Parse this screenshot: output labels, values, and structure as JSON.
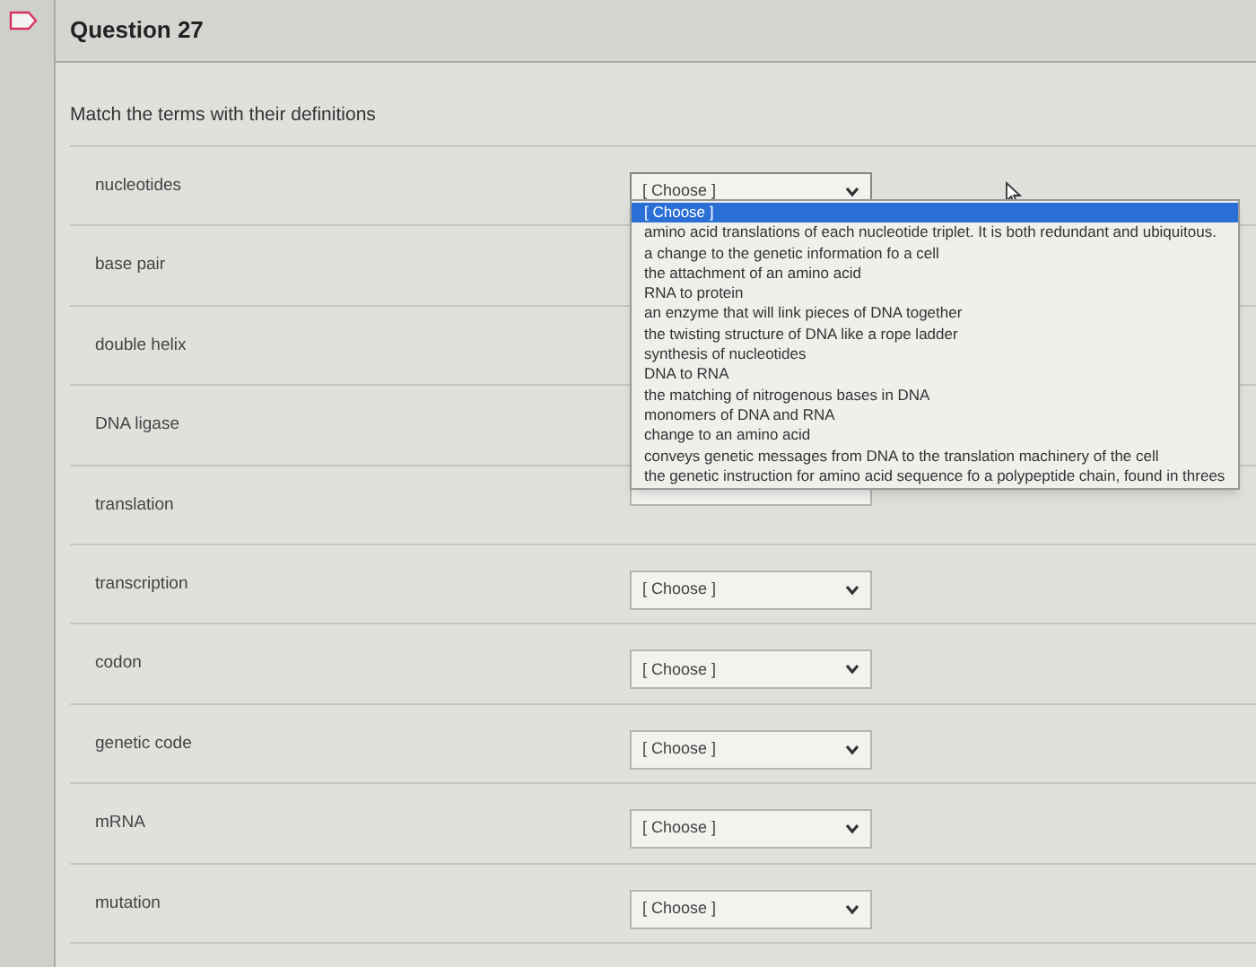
{
  "question": {
    "title": "Question 27",
    "prompt": "Match the terms with their definitions"
  },
  "rows": [
    {
      "term": "nucleotides",
      "choice": "[ Choose ]",
      "open": true
    },
    {
      "term": "base pair"
    },
    {
      "term": "double helix"
    },
    {
      "term": "DNA ligase"
    },
    {
      "term": "translation",
      "covered": true
    },
    {
      "term": "transcription",
      "choice": "[ Choose ]",
      "open": false
    },
    {
      "term": "codon",
      "choice": "[ Choose ]",
      "open": false
    },
    {
      "term": "genetic code",
      "choice": "[ Choose ]",
      "open": false
    },
    {
      "term": "mRNA",
      "choice": "[ Choose ]",
      "open": false
    },
    {
      "term": "mutation",
      "choice": "[ Choose ]",
      "open": false
    }
  ],
  "dropdown": {
    "options": [
      {
        "label": "[ Choose ]",
        "selected": true
      },
      {
        "label": "amino acid translations of each nucleotide triplet. It is both redundant and ubiquitous.",
        "selected": false
      },
      {
        "label": "a change to the genetic information fo a cell",
        "selected": false
      },
      {
        "label": "the attachment of an amino acid",
        "selected": false
      },
      {
        "label": "RNA to protein",
        "selected": false
      },
      {
        "label": "an enzyme that will link pieces of DNA together",
        "selected": false
      },
      {
        "label": "the twisting structure of DNA like a rope ladder",
        "selected": false
      },
      {
        "label": "synthesis of nucleotides",
        "selected": false
      },
      {
        "label": "DNA to RNA",
        "selected": false
      },
      {
        "label": "the matching of nitrogenous bases in DNA",
        "selected": false
      },
      {
        "label": "monomers of DNA and RNA",
        "selected": false
      },
      {
        "label": "change to an amino acid",
        "selected": false
      },
      {
        "label": "conveys genetic messages from DNA to the translation machinery of the cell",
        "selected": false
      },
      {
        "label": "the genetic instruction for amino acid sequence fo a polypeptide chain, found in threes",
        "selected": false
      }
    ]
  }
}
